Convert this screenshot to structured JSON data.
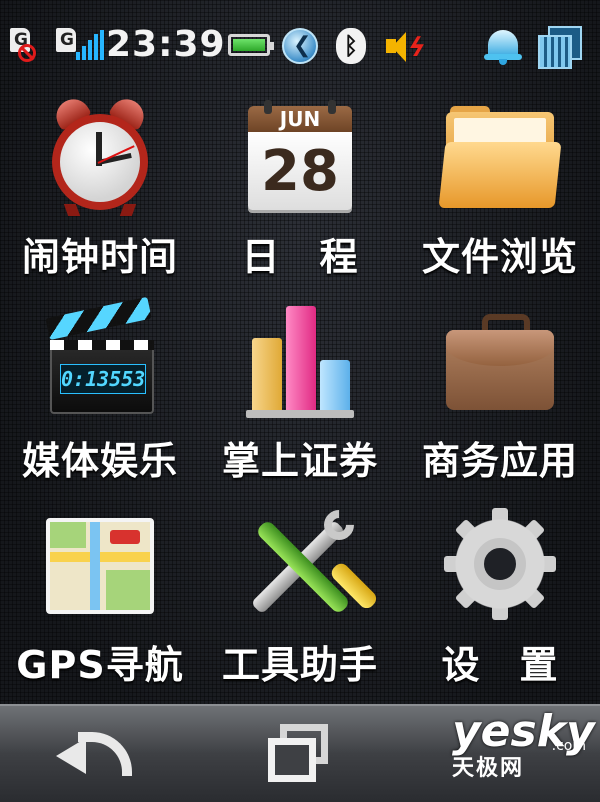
{
  "status_bar": {
    "sim1_label": "G",
    "sim2_label": "G",
    "time": "23:39",
    "icons": [
      "sim-disabled-icon",
      "signal-strength-icon",
      "battery-icon",
      "sync-icon",
      "bluetooth-icon",
      "speaker-icon",
      "alarm-bell-icon",
      "calendar-icon"
    ],
    "bluetooth_glyph": "ʙ"
  },
  "apps": [
    {
      "label": "闹钟时间",
      "icon": "alarm-clock-icon"
    },
    {
      "label": "日　程",
      "icon": "calendar-icon",
      "month": "JUN",
      "day": "28"
    },
    {
      "label": "文件浏览",
      "icon": "folder-icon"
    },
    {
      "label": "媒体娱乐",
      "icon": "clapperboard-icon",
      "display": "0:13553"
    },
    {
      "label": "掌上证券",
      "icon": "bar-chart-icon"
    },
    {
      "label": "商务应用",
      "icon": "briefcase-icon"
    },
    {
      "label": "GPS寻航",
      "icon": "map-icon"
    },
    {
      "label": "工具助手",
      "icon": "tools-icon"
    },
    {
      "label": "设　置",
      "icon": "gear-icon"
    }
  ],
  "bottom_bar": {
    "back_icon": "back-arrow-icon",
    "windows_icon": "switch-windows-icon"
  },
  "watermark": {
    "brand": "yesky",
    "domain": ".com",
    "chinese": "天极网"
  },
  "colors": {
    "accent_blue": "#27b6ff",
    "battery_green": "#2ea82a",
    "alarm_red": "#b3261b"
  }
}
